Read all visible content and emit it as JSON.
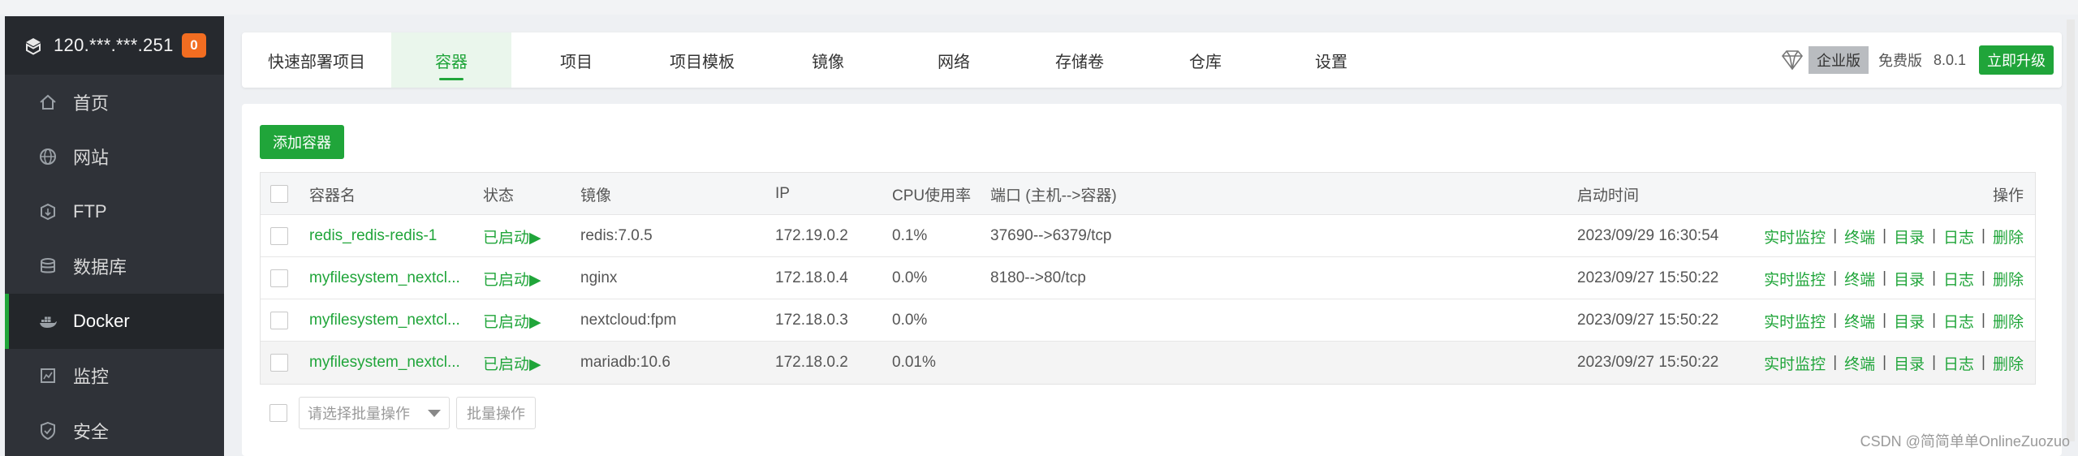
{
  "sidebar": {
    "server_ip": "120.***.***.251",
    "badge_count": "0",
    "items": [
      {
        "label": "首页",
        "icon": "home-icon"
      },
      {
        "label": "网站",
        "icon": "globe-icon"
      },
      {
        "label": "FTP",
        "icon": "ftp-icon"
      },
      {
        "label": "数据库",
        "icon": "database-icon"
      },
      {
        "label": "Docker",
        "icon": "docker-icon",
        "active": true
      },
      {
        "label": "监控",
        "icon": "monitor-icon"
      },
      {
        "label": "安全",
        "icon": "shield-icon"
      }
    ]
  },
  "tabs": [
    {
      "label": "快速部署项目"
    },
    {
      "label": "容器",
      "active": true
    },
    {
      "label": "项目"
    },
    {
      "label": "项目模板"
    },
    {
      "label": "镜像"
    },
    {
      "label": "网络"
    },
    {
      "label": "存储卷"
    },
    {
      "label": "仓库"
    },
    {
      "label": "设置"
    }
  ],
  "header_right": {
    "edition_badge": "企业版",
    "free_text": "免费版",
    "version": "8.0.1",
    "upgrade_label": "立即升级"
  },
  "main": {
    "add_button": "添加容器",
    "columns": {
      "name": "容器名",
      "status": "状态",
      "image": "镜像",
      "ip": "IP",
      "cpu": "CPU使用率",
      "port": "端口 (主机-->容器)",
      "time": "启动时间",
      "ops": "操作"
    },
    "rows": [
      {
        "name": "redis_redis-redis-1",
        "status": "已启动▶",
        "image": "redis:7.0.5",
        "ip": "172.19.0.2",
        "cpu": "0.1%",
        "port": "37690-->6379/tcp",
        "time": "2023/09/29 16:30:54"
      },
      {
        "name": "myfilesystem_nextcl...",
        "status": "已启动▶",
        "image": "nginx",
        "ip": "172.18.0.4",
        "cpu": "0.0%",
        "port": "8180-->80/tcp",
        "time": "2023/09/27 15:50:22"
      },
      {
        "name": "myfilesystem_nextcl...",
        "status": "已启动▶",
        "image": "nextcloud:fpm",
        "ip": "172.18.0.3",
        "cpu": "0.0%",
        "port": "",
        "time": "2023/09/27 15:50:22"
      },
      {
        "name": "myfilesystem_nextcl...",
        "status": "已启动▶",
        "image": "mariadb:10.6",
        "ip": "172.18.0.2",
        "cpu": "0.01%",
        "port": "",
        "time": "2023/09/27 15:50:22"
      }
    ],
    "ops": [
      "实时监控",
      "终端",
      "目录",
      "日志",
      "删除"
    ],
    "ops_separator": "|",
    "batch_placeholder": "请选择批量操作",
    "batch_button": "批量操作"
  },
  "watermark": "CSDN @简简单单OnlineZuozuo",
  "colors": {
    "accent": "#20a53a",
    "sidebar_bg": "#2f3238",
    "badge": "#f26d21"
  }
}
